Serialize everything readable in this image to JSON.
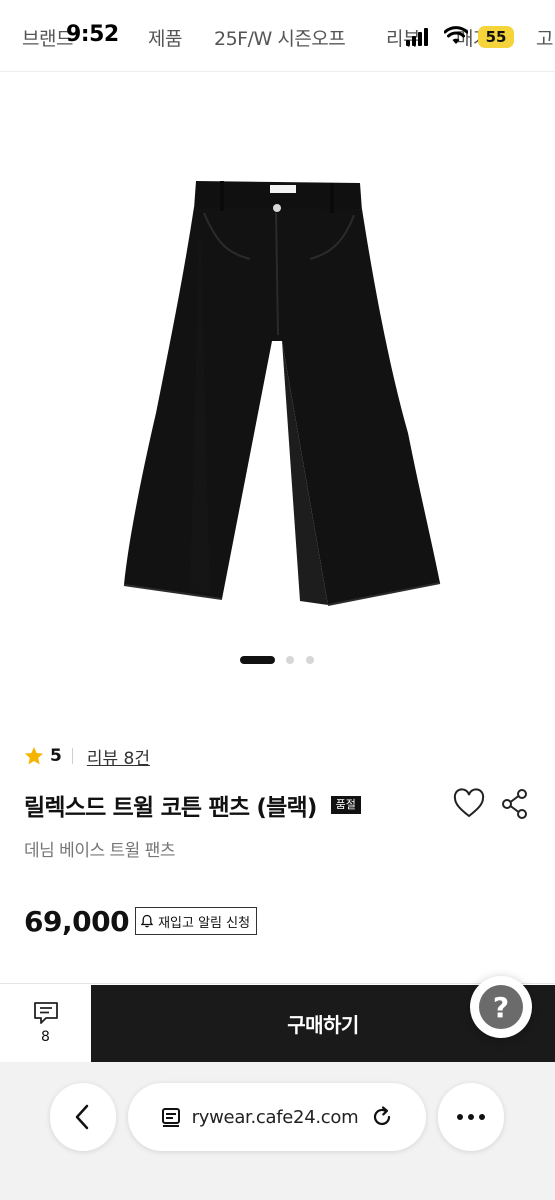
{
  "top_nav": {
    "items": [
      "브랜드",
      "제품",
      "25F/W 시즌오프",
      "리뷰",
      "매거진",
      "고"
    ]
  },
  "status_bar": {
    "time": "9:52",
    "battery": "55"
  },
  "product": {
    "image_alt": "black twill cotton pants",
    "carousel": {
      "current": 1,
      "total": 3
    },
    "rating": "5",
    "review_link": "리뷰 8건",
    "title": "릴렉스드 트윌 코튼 팬츠 (블랙)",
    "soldout_badge": "품절",
    "subtitle": "데님 베이스 트윌 팬츠",
    "price": "69,000",
    "restock_label": "재입고 알림 신청"
  },
  "buy_bar": {
    "chat_count": "8",
    "purchase_label": "구매하기",
    "help_label": "?"
  },
  "browser": {
    "url": "rywear.cafe24.com"
  },
  "colors": {
    "star": "#f5b400",
    "purchase_bg": "#1a1a1a",
    "battery_bg": "#f5d33b"
  },
  "icons": [
    "star-icon",
    "heart-icon",
    "share-icon",
    "bell-icon",
    "chat-icon",
    "help-icon",
    "back-icon",
    "reader-icon",
    "reload-icon",
    "more-icon",
    "signal-icon",
    "wifi-icon"
  ]
}
